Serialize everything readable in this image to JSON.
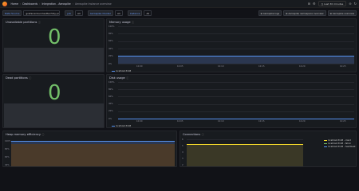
{
  "breadcrumb": [
    "Home",
    "Dashboards",
    "Integration - Aerospike",
    "Aerospike Instance overview"
  ],
  "topbar": {
    "time_range": "Last 30 minutes"
  },
  "variables": [
    {
      "label": "Data Source",
      "value": "grafanacloud-testtechhly-prom",
      "wide": true
    },
    {
      "label": "job",
      "value": "All",
      "wide": false
    },
    {
      "label": "Aerospike Cluster",
      "value": "All",
      "wide": false
    },
    {
      "label": "Instance",
      "value": "All",
      "wide": false
    }
  ],
  "dashboard_links": [
    "Aerospike logs",
    "Aerospike namespace overview",
    "Aerospike overview"
  ],
  "panels": {
    "unavailable": {
      "title": "Unavailable partitions",
      "value": "0"
    },
    "memory": {
      "title": "Memory usage",
      "y_ticks": [
        "100%",
        "80%",
        "60%",
        "40%",
        "20%",
        "0%"
      ],
      "x_ticks": [
        "10:00",
        "10:05",
        "10:10",
        "10:15",
        "10:20",
        "10:25"
      ],
      "legend": "localhost:3148"
    },
    "dead": {
      "title": "Dead partitions",
      "value": "0"
    },
    "disk": {
      "title": "Disk usage",
      "y_ticks": [
        "100%",
        "80%",
        "60%",
        "40%",
        "20%",
        "0%"
      ],
      "x_ticks": [
        "10:00",
        "10:05",
        "10:10",
        "10:15",
        "10:20",
        "10:25"
      ],
      "legend": "localhost:3148"
    },
    "heap": {
      "title": "Heap memory efficiency",
      "y_ticks": [
        "100%",
        "80%",
        "60%",
        "40%"
      ]
    },
    "connections": {
      "title": "Connections",
      "y_ticks": [
        "6",
        "5",
        "4",
        "3",
        "2"
      ],
      "legend": [
        "localhost:3148 - client",
        "localhost:3148 - fabric",
        "localhost:3148 - heartbeat"
      ]
    }
  },
  "colors": {
    "green": "#73bf69",
    "blue": "#5794f2",
    "yellow": "#fade2a",
    "orange": "#ff9830"
  }
}
